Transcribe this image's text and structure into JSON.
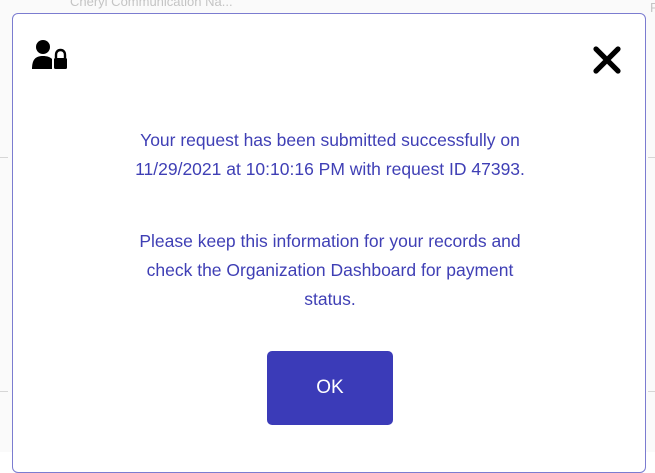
{
  "background": {
    "top_fragment": "Cheryl Communication Na...",
    "right_fragment": "Fi"
  },
  "dialog": {
    "icon": "user-lock-icon",
    "close_icon": "close-icon",
    "message_1_lines": [
      "Your request has been submitted successfully on",
      "11/29/2021 at 10:10:16 PM with request ID 47393."
    ],
    "message_2_lines": [
      "Please keep this information for your records and",
      "check the Organization Dashboard for payment",
      "status."
    ],
    "ok_label": "OK"
  },
  "colors": {
    "text": "#3f3fb5",
    "button": "#3b3bb8",
    "border": "#7b7cd0"
  }
}
